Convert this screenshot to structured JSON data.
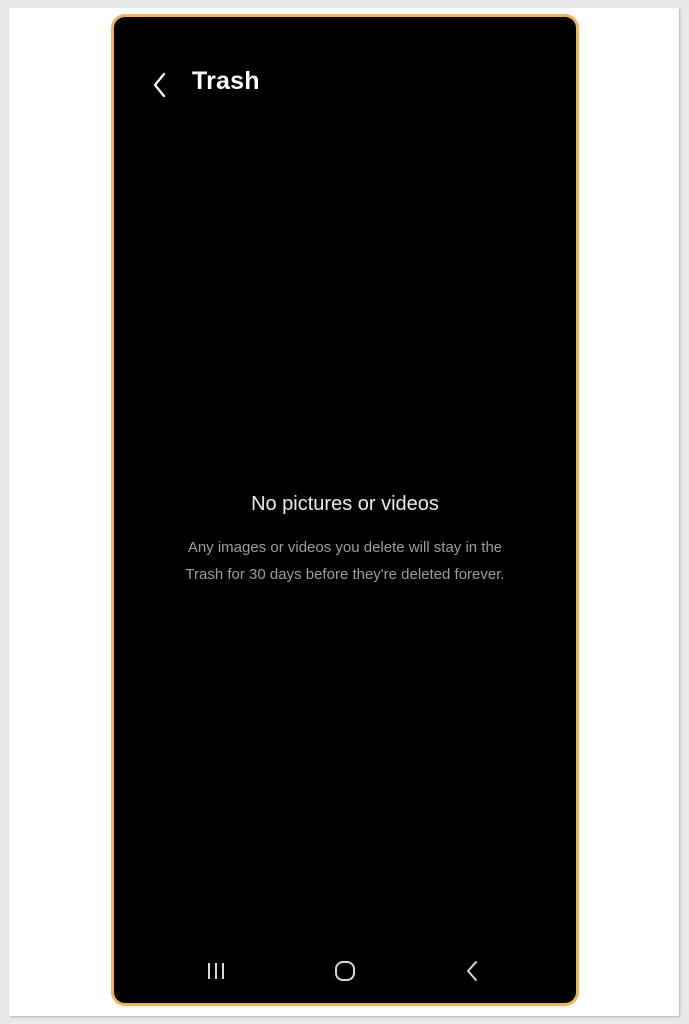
{
  "header": {
    "title": "Trash",
    "back_icon": "chevron-left-icon"
  },
  "empty_state": {
    "title": "No pictures or videos",
    "description": "Any images or videos you delete will stay in the Trash for 30 days before they're deleted forever."
  },
  "navbar": {
    "recents_icon": "recent-apps-icon",
    "home_icon": "home-icon",
    "back_icon": "back-icon"
  },
  "colors": {
    "frame_accent": "#f0b45a",
    "screen_bg": "#000000",
    "primary_text": "#ffffff",
    "secondary_text": "#9d9d9d"
  }
}
